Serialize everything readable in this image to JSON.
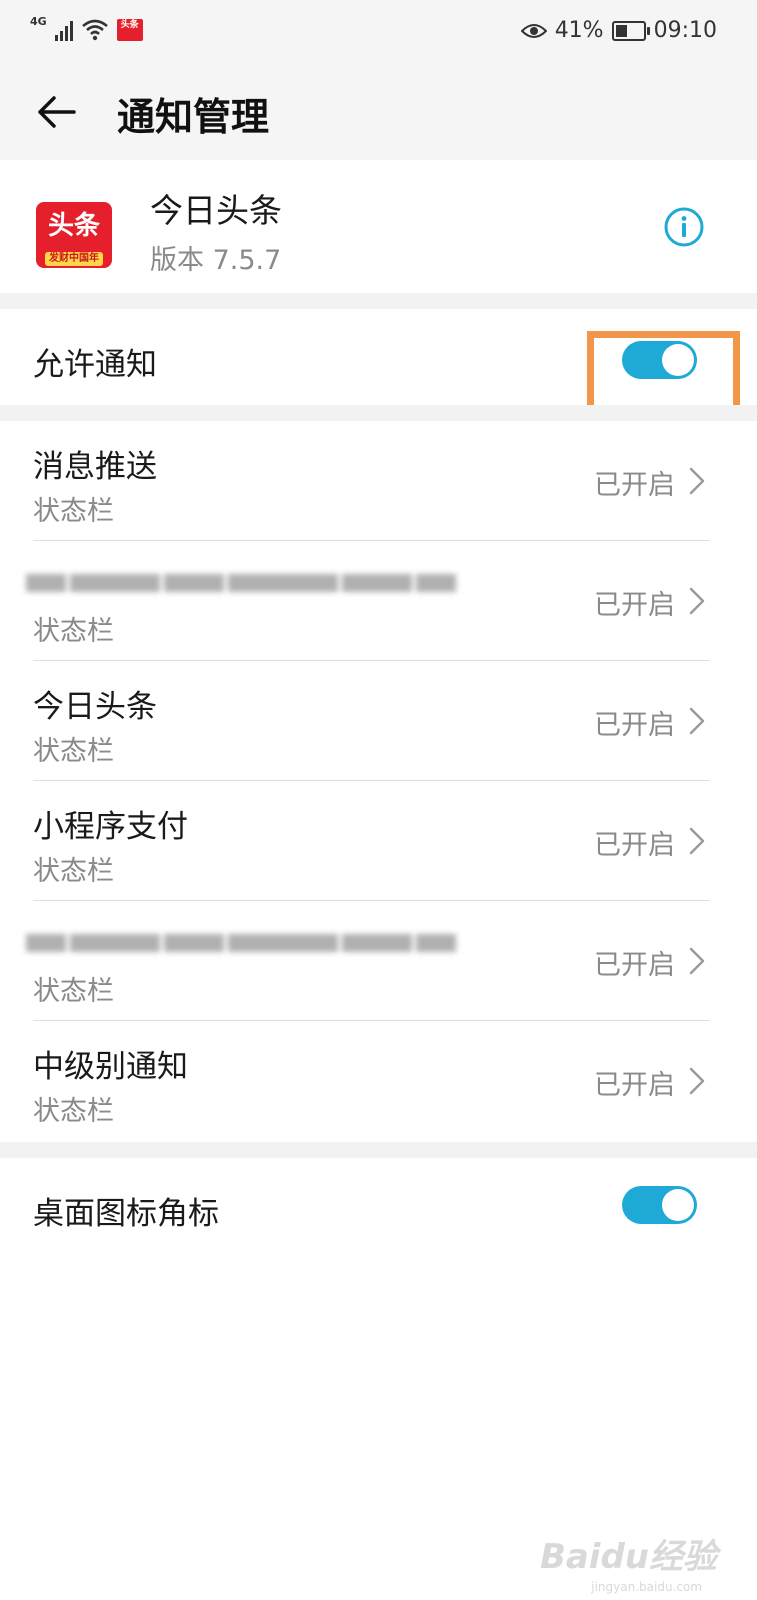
{
  "status_bar": {
    "network": "4G",
    "battery_percent": "41%",
    "battery_level": 0.41,
    "time": "09:10",
    "notification_app": "头条"
  },
  "header": {
    "title": "通知管理",
    "back_icon": "back-arrow-icon"
  },
  "app": {
    "logo_text": "头条",
    "logo_tagline": "发财中国年",
    "name": "今日头条",
    "version": "版本 7.5.7",
    "info_icon": "info-icon"
  },
  "allow_notifications": {
    "label": "允许通知",
    "enabled": true
  },
  "channels": [
    {
      "name": "消息推送",
      "sub": "状态栏",
      "status": "已开启",
      "blurred": false
    },
    {
      "name": "",
      "sub": "状态栏",
      "status": "已开启",
      "blurred": true
    },
    {
      "name": "今日头条",
      "sub": "状态栏",
      "status": "已开启",
      "blurred": false
    },
    {
      "name": "小程序支付",
      "sub": "状态栏",
      "status": "已开启",
      "blurred": false
    },
    {
      "name": "",
      "sub": "状态栏",
      "status": "已开启",
      "blurred": true
    },
    {
      "name": "中级别通知",
      "sub": "状态栏",
      "status": "已开启",
      "blurred": false
    }
  ],
  "badge": {
    "label": "桌面图标角标",
    "enabled": true
  },
  "watermark": {
    "text": "Baidu经验",
    "sub": "jingyan.baidu.com"
  },
  "colors": {
    "accent": "#1fa9d6",
    "highlight_box": "#f2964a",
    "brand_red": "#e5202c"
  }
}
